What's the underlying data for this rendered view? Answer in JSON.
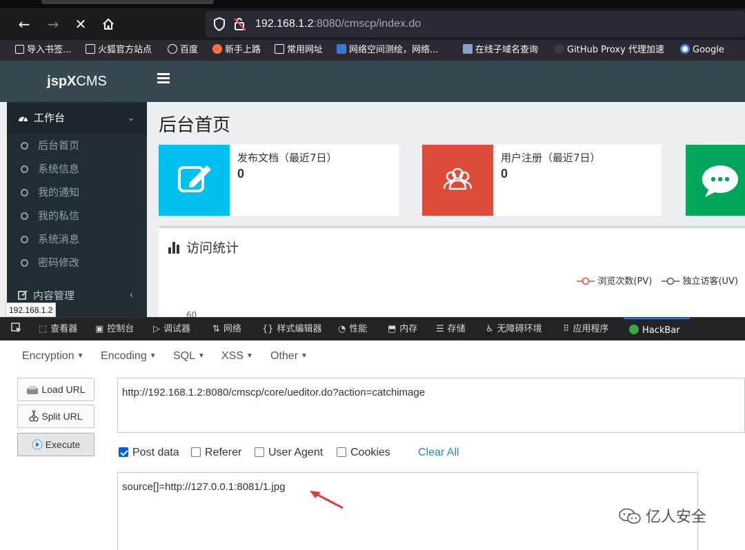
{
  "browser": {
    "url_host": "192.168.1.2",
    "url_rest": ":8080/cmscp/index.do",
    "bookmarks": [
      {
        "label": "导入书签...",
        "icon": "import-icon"
      },
      {
        "label": "火狐官方站点",
        "icon": "folder-icon"
      },
      {
        "label": "百度",
        "icon": "globe-icon"
      },
      {
        "label": "新手上路",
        "icon": "firefox-icon"
      },
      {
        "label": "常用网址",
        "icon": "folder-icon"
      },
      {
        "label": "网络空间测绘，网络...",
        "icon": "fofa-icon"
      },
      {
        "label": "在线子域名查询",
        "icon": "site-icon"
      },
      {
        "label": "GitHub Proxy 代理加速",
        "icon": "github-icon"
      },
      {
        "label": "Google",
        "icon": "google-icon"
      }
    ]
  },
  "cms": {
    "logo_bold": "jspX",
    "logo_rest": "CMS",
    "sidebar": {
      "workbench": "工作台",
      "items": [
        "后台首页",
        "系统信息",
        "我的通知",
        "我的私信",
        "系统消息",
        "密码修改"
      ],
      "content_mgmt": "内容管理"
    },
    "page_title": "后台首页",
    "infoboxes": [
      {
        "label": "发布文档（最近7日）",
        "value": "0",
        "color": "#00c0ef"
      },
      {
        "label": "用户注册（最近7日）",
        "value": "0",
        "color": "#dd4b39"
      },
      {
        "label": "",
        "value": "",
        "color": "#00a65a"
      }
    ],
    "stats_title": "访问统计",
    "legend": [
      "浏览次数(PV)",
      "独立访客(UV)"
    ],
    "legend_colors": [
      "#dd4b39",
      "#555555"
    ],
    "axis_tick": "60",
    "status_tip": "192.168.1.2"
  },
  "devtools": {
    "tabs": [
      "查看器",
      "控制台",
      "调试器",
      "网络",
      "样式编辑器",
      "性能",
      "内存",
      "存储",
      "无障碍环境",
      "应用程序",
      "HackBar"
    ]
  },
  "hackbar": {
    "menus": [
      "Encryption",
      "Encoding",
      "SQL",
      "XSS",
      "Other"
    ],
    "buttons": [
      "Load URL",
      "Split URL",
      "Execute"
    ],
    "url_value": "http://192.168.1.2:8080/cmscp/core/ueditor.do?action=catchimage",
    "checks": [
      {
        "label": "Post data",
        "checked": true
      },
      {
        "label": "Referer",
        "checked": false
      },
      {
        "label": "User Agent",
        "checked": false
      },
      {
        "label": "Cookies",
        "checked": false
      }
    ],
    "clear_all": "Clear All",
    "post_value": "source[]=http://127.0.0.1:8081/1.jpg",
    "watermark": "亿人安全"
  }
}
